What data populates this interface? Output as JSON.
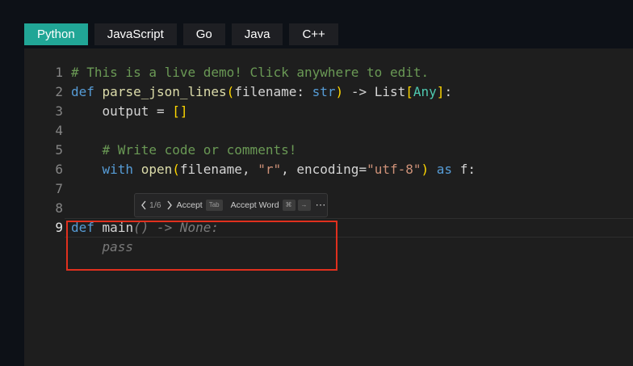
{
  "tabs": [
    {
      "label": "Python",
      "active": true
    },
    {
      "label": "JavaScript",
      "active": false
    },
    {
      "label": "Go",
      "active": false
    },
    {
      "label": "Java",
      "active": false
    },
    {
      "label": "C++",
      "active": false
    }
  ],
  "editor": {
    "current_line": 9,
    "lines": [
      {
        "n": "1",
        "tokens": [
          {
            "t": "# This is a live demo! Click anywhere to edit.",
            "k": "comment"
          }
        ]
      },
      {
        "n": "2",
        "tokens": [
          {
            "t": "def",
            "k": "kw"
          },
          {
            "t": " ",
            "k": "plain"
          },
          {
            "t": "parse_json_lines",
            "k": "fn"
          },
          {
            "t": "(",
            "k": "br"
          },
          {
            "t": "filename: ",
            "k": "plain"
          },
          {
            "t": "str",
            "k": "kw"
          },
          {
            "t": ")",
            "k": "br"
          },
          {
            "t": " -> List",
            "k": "plain"
          },
          {
            "t": "[",
            "k": "br"
          },
          {
            "t": "Any",
            "k": "type"
          },
          {
            "t": "]",
            "k": "br"
          },
          {
            "t": ":",
            "k": "plain"
          }
        ]
      },
      {
        "n": "3",
        "tokens": [
          {
            "t": "    output = ",
            "k": "plain"
          },
          {
            "t": "[]",
            "k": "br"
          }
        ]
      },
      {
        "n": "4",
        "tokens": []
      },
      {
        "n": "5",
        "tokens": [
          {
            "t": "    ",
            "k": "plain"
          },
          {
            "t": "# Write code or comments!",
            "k": "comment"
          }
        ]
      },
      {
        "n": "6",
        "tokens": [
          {
            "t": "    ",
            "k": "plain"
          },
          {
            "t": "with",
            "k": "kw"
          },
          {
            "t": " ",
            "k": "plain"
          },
          {
            "t": "open",
            "k": "fn"
          },
          {
            "t": "(",
            "k": "br"
          },
          {
            "t": "filename, ",
            "k": "plain"
          },
          {
            "t": "\"r\"",
            "k": "str"
          },
          {
            "t": ", encoding=",
            "k": "plain"
          },
          {
            "t": "\"utf-8\"",
            "k": "str"
          },
          {
            "t": ")",
            "k": "br"
          },
          {
            "t": " ",
            "k": "plain"
          },
          {
            "t": "as",
            "k": "kw"
          },
          {
            "t": " f:",
            "k": "plain"
          }
        ]
      },
      {
        "n": "7",
        "tokens": []
      },
      {
        "n": "8",
        "tokens": []
      },
      {
        "n": "9",
        "tokens": [
          {
            "t": "def",
            "k": "kw"
          },
          {
            "t": " ",
            "k": "plain"
          },
          {
            "t": "main",
            "k": "plain"
          },
          {
            "t": "() -> None:",
            "k": "ghost"
          }
        ]
      },
      {
        "n": "",
        "tokens": [
          {
            "t": "    pass",
            "k": "ghost"
          }
        ]
      }
    ]
  },
  "suggestion_widget": {
    "count": "1/6",
    "accept_label": "Accept",
    "accept_key": "Tab",
    "accept_word_label": "Accept Word",
    "accept_word_key1": "⌘",
    "accept_word_key2": "→",
    "more": "⋯"
  }
}
